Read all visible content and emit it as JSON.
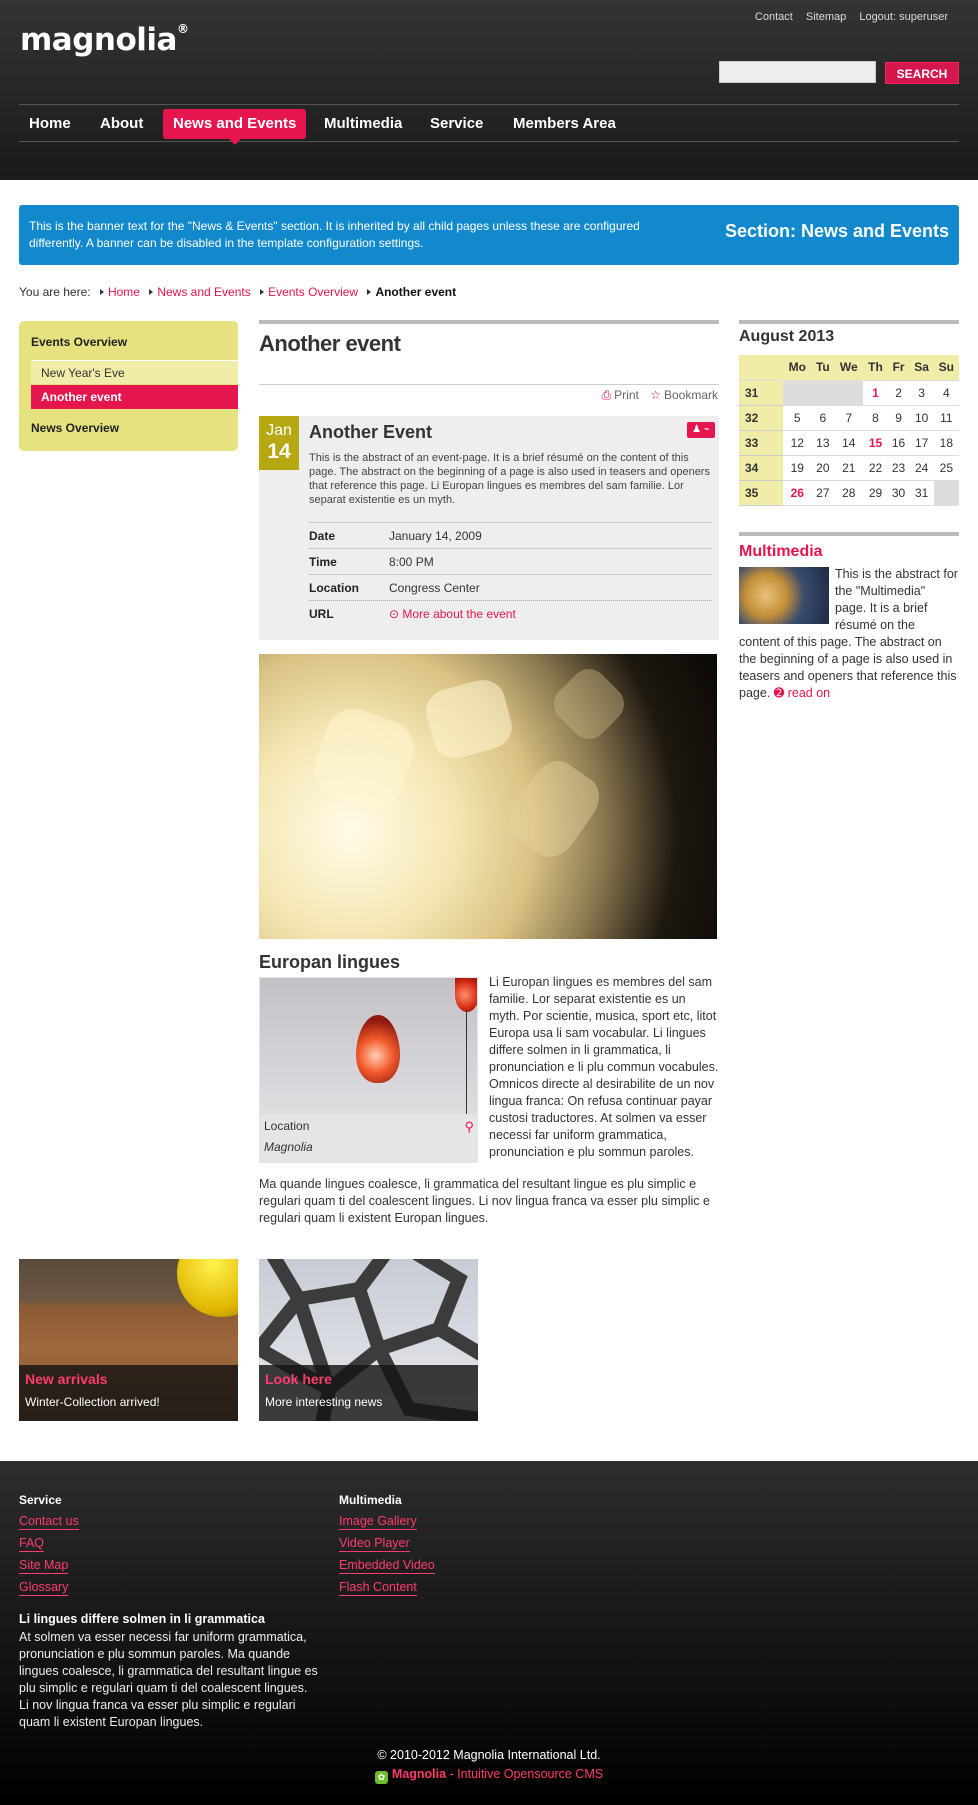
{
  "header": {
    "logo": "magnolia",
    "logo_mark": "®",
    "meta_links": [
      "Contact",
      "Sitemap",
      "Logout: superuser"
    ],
    "search": {
      "placeholder": "",
      "button": "SEARCH"
    },
    "nav": [
      {
        "label": "Home"
      },
      {
        "label": "About"
      },
      {
        "label": "News and Events",
        "active": true
      },
      {
        "label": "Multimedia"
      },
      {
        "label": "Service"
      },
      {
        "label": "Members Area"
      }
    ]
  },
  "banner": {
    "text": "This is the banner text for the \"News & Events\" section. It is inherited by all child pages unless these are configured differently. A banner can be disabled in the template configuration settings.",
    "section": "Section: News and Events"
  },
  "breadcrumb": {
    "prefix": "You are here:",
    "items": [
      "Home",
      "News and Events",
      "Events Overview"
    ],
    "current": "Another event"
  },
  "subnav": {
    "title": "Events Overview",
    "items": [
      {
        "label": "New Year's Eve"
      },
      {
        "label": "Another event",
        "active": true
      }
    ],
    "second": "News Overview"
  },
  "main": {
    "title": "Another event",
    "tools": [
      "Print",
      "Bookmark"
    ],
    "event": {
      "month": "Jan",
      "day": "14",
      "title": "Another Event",
      "abstract": "This is the abstract of an event-page. It is a brief résumé on the content of this page. The abstract on the beginning of a page is also used in teasers and openers that reference this page. Li Europan lingues es membres del sam familie. Lor separat existentie es un myth.",
      "rows": [
        {
          "label": "Date",
          "value": "January 14, 2009"
        },
        {
          "label": "Time",
          "value": "8:00 PM"
        },
        {
          "label": "Location",
          "value": "Congress Center"
        },
        {
          "label": "URL",
          "value": "More about the event"
        }
      ]
    },
    "subheading": "Europan lingues",
    "figure": {
      "caption": "Location",
      "credit": "Magnolia"
    },
    "text_1": "Li Europan lingues es membres del sam familie. Lor separat existentie es un myth. Por scientie, musica, sport etc, litot Europa usa li sam vocabular. Li lingues differe solmen in li grammatica, li pronunciation e li plu commun vocabules. Omnicos directe al desirabilite de un nov lingua franca: On refusa continuar payar custosi traductores. At solmen va esser necessi far uniform grammatica, pronunciation e plu sommun paroles.",
    "text_2": "Ma quande lingues coalesce, li grammatica del resultant lingue es plu simplic e regulari quam ti del coalescent lingues. Li nov lingua franca va esser plu simplic e regulari quam li existent Europan lingues."
  },
  "teasers": [
    {
      "title": "New arrivals",
      "text": "Winter-Collection arrived!"
    },
    {
      "title": "Look here",
      "text": "More interesting news"
    }
  ],
  "sidebar": {
    "calendar": {
      "title": "August 2013",
      "days": [
        "Mo",
        "Tu",
        "We",
        "Th",
        "Fr",
        "Sa",
        "Su"
      ],
      "weeks": [
        {
          "week": "31",
          "days": [
            "",
            "",
            "",
            "1",
            "2",
            "3",
            "4"
          ]
        },
        {
          "week": "32",
          "days": [
            "5",
            "6",
            "7",
            "8",
            "9",
            "10",
            "11"
          ]
        },
        {
          "week": "33",
          "days": [
            "12",
            "13",
            "14",
            "15",
            "16",
            "17",
            "18"
          ]
        },
        {
          "week": "34",
          "days": [
            "19",
            "20",
            "21",
            "22",
            "23",
            "24",
            "25"
          ]
        },
        {
          "week": "35",
          "days": [
            "26",
            "27",
            "28",
            "29",
            "30",
            "31",
            ""
          ]
        }
      ],
      "highlighted": [
        "1",
        "15",
        "26"
      ]
    },
    "multimedia": {
      "title": "Multimedia",
      "text": "This is the abstract for the \"Multimedia\" page. It is a brief résumé on the content of this page. The abstract on the beginning of a page is also used in teasers and openers that reference this page.",
      "read_on": "read on"
    }
  },
  "footer": {
    "col1": {
      "title": "Service",
      "links": [
        "Contact us",
        "FAQ",
        "Site Map",
        "Glossary"
      ]
    },
    "col2": {
      "title": "Multimedia",
      "links": [
        "Image Gallery",
        "Video Player",
        "Embedded Video",
        "Flash Content"
      ]
    },
    "heading": "Li lingues differe solmen in li grammatica",
    "text": "At solmen va esser necessi far uniform grammatica, pronunciation e plu sommun paroles. Ma quande lingues coalesce, li grammatica del resultant lingue es plu simplic e regulari quam ti del coalescent lingues. Li nov lingua franca va esser plu simplic e regulari quam li existent Europan lingues.",
    "copyright": "© 2010-2012 Magnolia International Ltd.",
    "brand": "Magnolia",
    "tagline": " - Intuitive Opensource CMS"
  },
  "colors": {
    "accent": "#e5164d",
    "banner": "#1189cc",
    "subnav": "#e5e27f",
    "date_badge": "#b5a812"
  }
}
